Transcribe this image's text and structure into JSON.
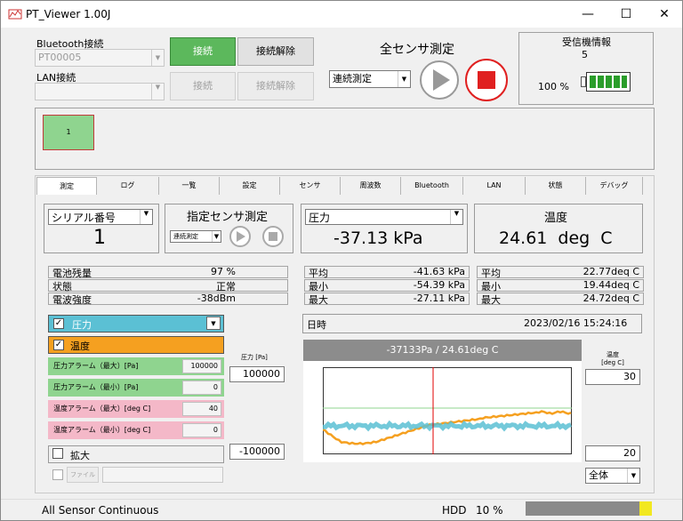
{
  "window": {
    "title": "PT_Viewer 1.00J",
    "min": "—",
    "max": "☐",
    "close": "✕"
  },
  "bluetooth": {
    "label": "Bluetooth接続",
    "device": "PT00005",
    "connect": "接続",
    "disconnect": "接続解除"
  },
  "lan": {
    "label": "LAN接続",
    "device": "",
    "connect": "接続",
    "disconnect": "接続解除"
  },
  "all_measure": {
    "title": "全センサ測定",
    "mode": "連続測定"
  },
  "receiver": {
    "title": "受信機情報",
    "count": "5",
    "battery_text": "100 %",
    "battery_level": 100
  },
  "sensor_tile": {
    "label": "1"
  },
  "tabs": [
    "測定",
    "ログ",
    "一覧",
    "設定",
    "センサ",
    "周波数",
    "Bluetooth",
    "LAN",
    "状態",
    "デバッグ"
  ],
  "serial": {
    "label": "シリアル番号",
    "value": "1"
  },
  "specific": {
    "title": "指定センサ測定",
    "mode": "連続測定"
  },
  "pressure": {
    "label": "圧力",
    "value": "-37.13 kPa"
  },
  "temperature": {
    "label": "温度",
    "value": "24.61 deg C"
  },
  "info": [
    {
      "k": "電池残量",
      "v": "97 %"
    },
    {
      "k": "状態",
      "v": "正常"
    },
    {
      "k": "電波強度",
      "v": "-38dBm"
    }
  ],
  "p_stats": [
    {
      "k": "平均",
      "v": "-41.63 kPa"
    },
    {
      "k": "最小",
      "v": "-54.39 kPa"
    },
    {
      "k": "最大",
      "v": "-27.11 kPa"
    }
  ],
  "t_stats": [
    {
      "k": "平均",
      "v": "22.77deq C"
    },
    {
      "k": "最小",
      "v": "19.44deq C"
    },
    {
      "k": "最大",
      "v": "24.72deq C"
    }
  ],
  "datetime": {
    "label": "日時",
    "value": "2023/02/16 15:24:16"
  },
  "series_toggle": {
    "pressure": "圧力",
    "temperature": "温度"
  },
  "alarms": [
    {
      "label": "圧力アラーム（最大）[Pa]",
      "value": "100000"
    },
    {
      "label": "圧力アラーム（最小）[Pa]",
      "value": "0"
    },
    {
      "label": "温度アラーム（最大）[deg C]",
      "value": "40"
    },
    {
      "label": "温度アラーム（最小）[deg C]",
      "value": "0"
    }
  ],
  "zoom": {
    "label": "拡大"
  },
  "file": {
    "btn": "ファイル"
  },
  "graph": {
    "header": "-37133Pa / 24.61deg C",
    "p_axis_label": "圧力 [Pa]",
    "p_max": "100000",
    "p_min": "-100000",
    "t_axis_label": "温度 [deg C]",
    "t_max": "30",
    "t_min": "20",
    "range": "全体",
    "colors": {
      "pressure": "#5bc0d4",
      "temperature": "#f5a020",
      "cursor": "#e00000",
      "ref": "#8fd48f"
    }
  },
  "status": {
    "mode": "All Sensor Continuous",
    "hdd_label": "HDD",
    "hdd_value": "10 %",
    "hdd_level": 10
  }
}
